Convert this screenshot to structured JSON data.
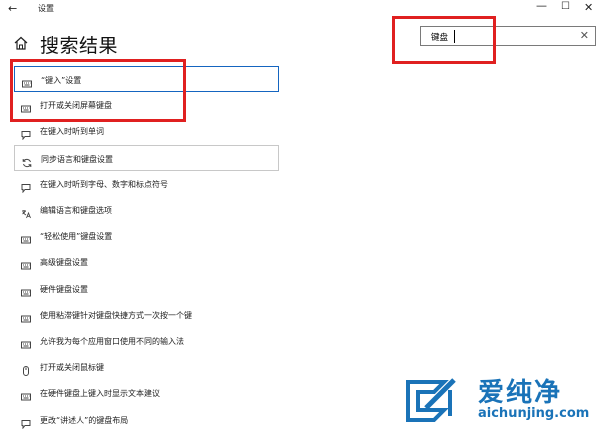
{
  "titlebar": {
    "app_title": "设置",
    "back_glyph": "←",
    "min_glyph": "—",
    "max_glyph": "☐",
    "close_glyph": "✕"
  },
  "header": {
    "title": "搜索结果",
    "home_icon": "home-icon"
  },
  "search": {
    "value": "键盘",
    "clear_glyph": "✕"
  },
  "results": [
    {
      "label": "“键入”设置",
      "icon": "keyboard-icon"
    },
    {
      "label": "打开或关闭屏幕键盘",
      "icon": "keyboard-icon"
    },
    {
      "label": "在键入时听到单词",
      "icon": "speech-icon"
    },
    {
      "label": "同步语言和键盘设置",
      "icon": "sync-icon"
    },
    {
      "label": "在键入时听到字母、数字和标点符号",
      "icon": "speech-icon"
    },
    {
      "label": "编辑语言和键盘选项",
      "icon": "language-icon"
    },
    {
      "label": "“轻松使用”键盘设置",
      "icon": "keyboard-icon"
    },
    {
      "label": "高级键盘设置",
      "icon": "keyboard-icon"
    },
    {
      "label": "硬件键盘设置",
      "icon": "keyboard-icon"
    },
    {
      "label": "使用粘滞键针对键盘快捷方式一次按一个键",
      "icon": "keyboard-icon"
    },
    {
      "label": "允许我为每个应用窗口使用不同的输入法",
      "icon": "keyboard-icon"
    },
    {
      "label": "打开或关闭鼠标键",
      "icon": "mouse-icon"
    },
    {
      "label": "在硬件键盘上键入时显示文本建议",
      "icon": "keyboard-icon"
    },
    {
      "label": "更改“讲述人”的键盘布局",
      "icon": "speech-icon"
    }
  ],
  "watermark": {
    "cn": "爱纯净",
    "en": "aichunjing.com"
  },
  "colors": {
    "annotation_red": "#e02020",
    "selected_border": "#1565c0",
    "watermark_blue": "#1a73b8"
  }
}
